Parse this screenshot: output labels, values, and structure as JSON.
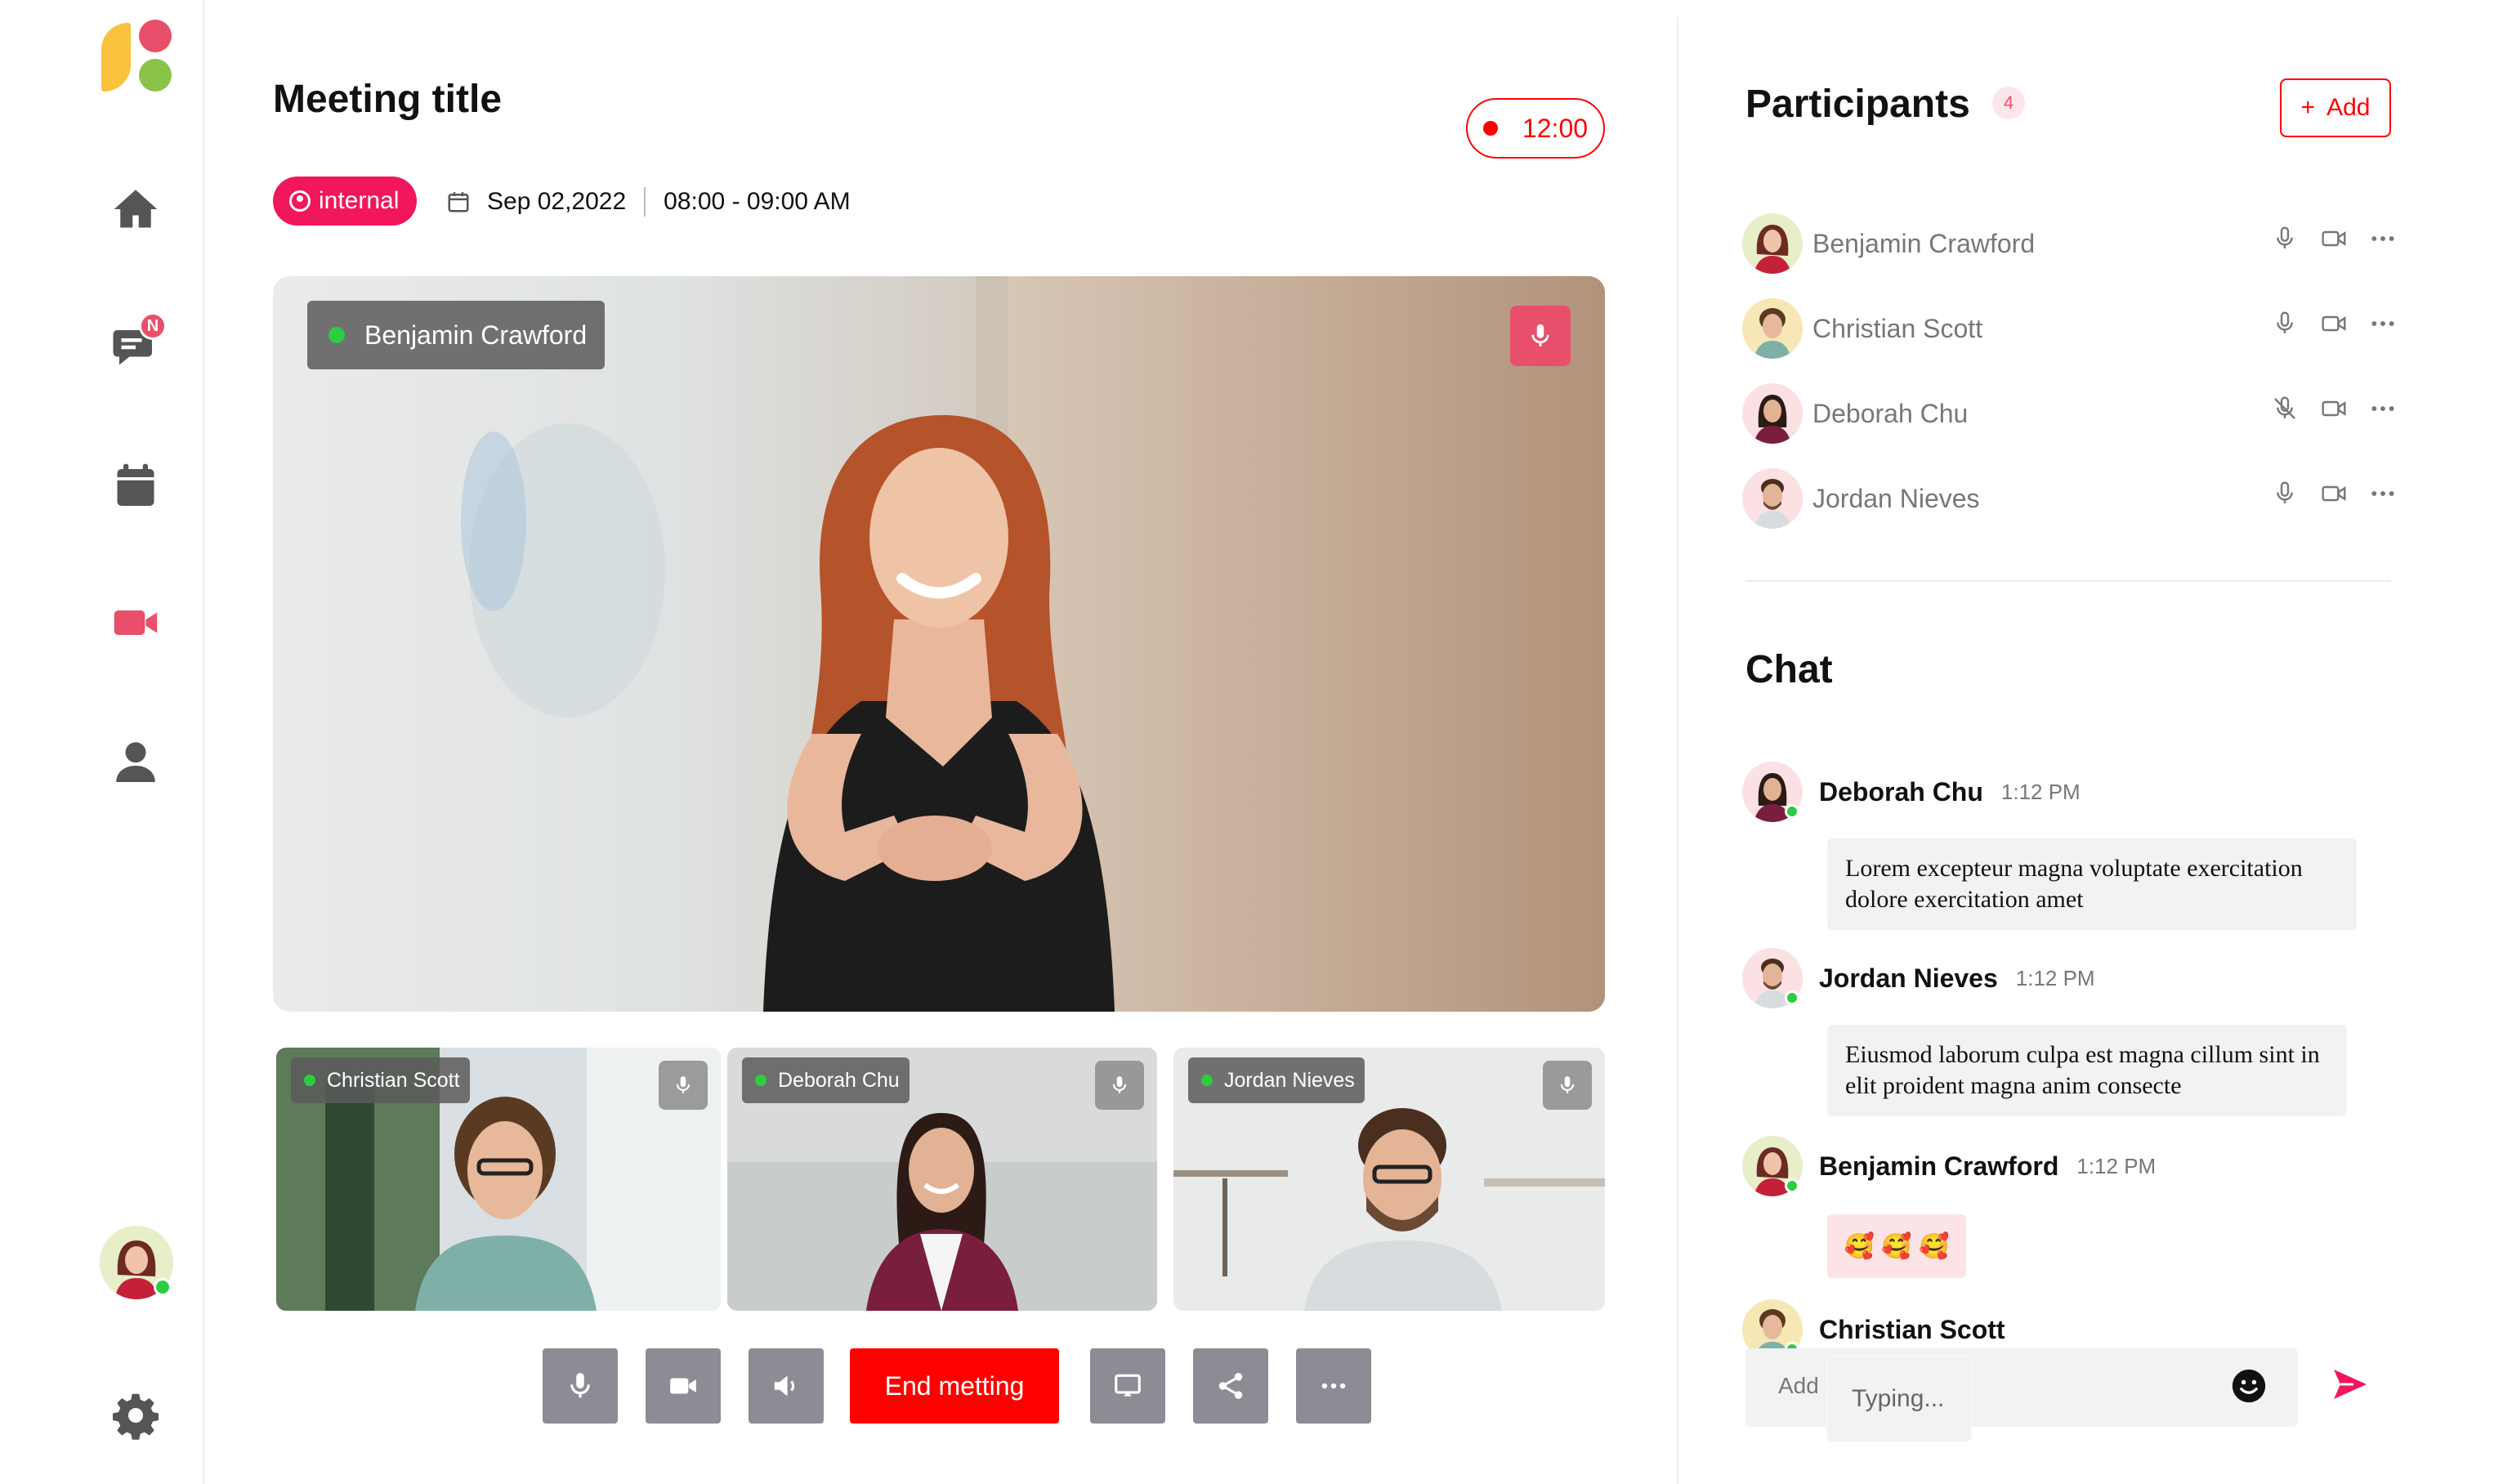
{
  "sidebar": {
    "notification_badge": "N",
    "icons": [
      "home-icon",
      "chat-icon",
      "calendar-icon",
      "video-icon",
      "user-icon",
      "settings-icon"
    ]
  },
  "meeting": {
    "title": "Meeting title",
    "timer": "12:00",
    "tag": "internal",
    "date": "Sep 02,2022",
    "time": "08:00 - 09:00 AM"
  },
  "video": {
    "main_name": "Benjamin Crawford",
    "thumbs": [
      {
        "name": "Christian Scott"
      },
      {
        "name": "Deborah Chu"
      },
      {
        "name": "Jordan Nieves"
      }
    ]
  },
  "controls": {
    "end_label": "End metting"
  },
  "participants": {
    "title": "Participants",
    "count": "4",
    "add_label": "Add",
    "add_symbol": "+",
    "list": [
      {
        "name": "Benjamin Crawford",
        "muted": false
      },
      {
        "name": "Christian Scott",
        "muted": false
      },
      {
        "name": "Deborah Chu",
        "muted": true
      },
      {
        "name": "Jordan Nieves",
        "muted": false
      }
    ]
  },
  "chat": {
    "title": "Chat",
    "messages": [
      {
        "name": "Deborah Chu",
        "time": "1:12 PM",
        "text": "Lorem excepteur magna voluptate exercitation dolore exercitation amet"
      },
      {
        "name": "Jordan Nieves",
        "time": "1:12 PM",
        "text": "Eiusmod laborum culpa est magna cillum sint in elit proident magna anim consecte"
      },
      {
        "name": "Benjamin Crawford",
        "time": "1:12 PM",
        "emoji": "🥰 🥰 🥰"
      },
      {
        "name": "Christian Scott"
      }
    ],
    "input_hint": "Add s",
    "input_placeholder": "Typing..."
  },
  "colors": {
    "accent": "#e94f6a",
    "red": "#ff0000",
    "control_gray": "#8c8c94",
    "online": "#2ecc40"
  }
}
